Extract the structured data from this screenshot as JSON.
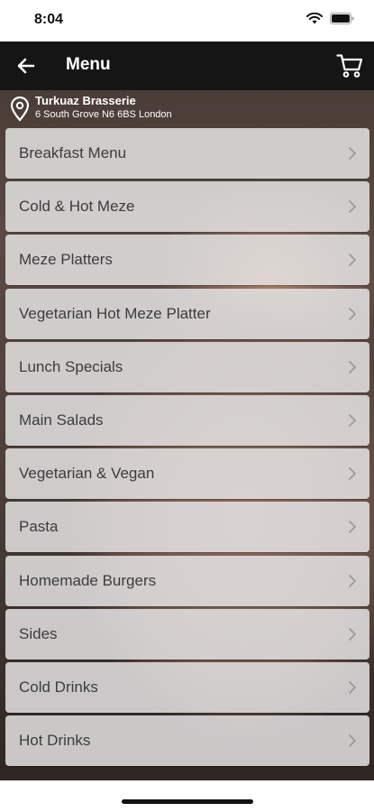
{
  "status_bar": {
    "time": "8:04",
    "icons": [
      "wifi-icon",
      "battery-icon"
    ]
  },
  "app_bar": {
    "title": "Menu",
    "back_icon": "arrow-left-icon",
    "cart_icon": "cart-icon",
    "background": "#151515"
  },
  "restaurant": {
    "name": "Turkuaz Brasserie",
    "address": "6 South Grove N6 6BS London",
    "icon": "location-pin-icon"
  },
  "menu": {
    "items": [
      {
        "label": "Breakfast Menu"
      },
      {
        "label": "Cold & Hot Meze"
      },
      {
        "label": "Meze Platters"
      },
      {
        "label": "Vegetarian Hot Meze Platter"
      },
      {
        "label": "Lunch Specials"
      },
      {
        "label": "Main Salads"
      },
      {
        "label": "Vegetarian & Vegan"
      },
      {
        "label": "Pasta"
      },
      {
        "label": "Homemade Burgers"
      },
      {
        "label": "Sides"
      },
      {
        "label": "Cold Drinks"
      },
      {
        "label": "Hot Drinks"
      }
    ]
  }
}
